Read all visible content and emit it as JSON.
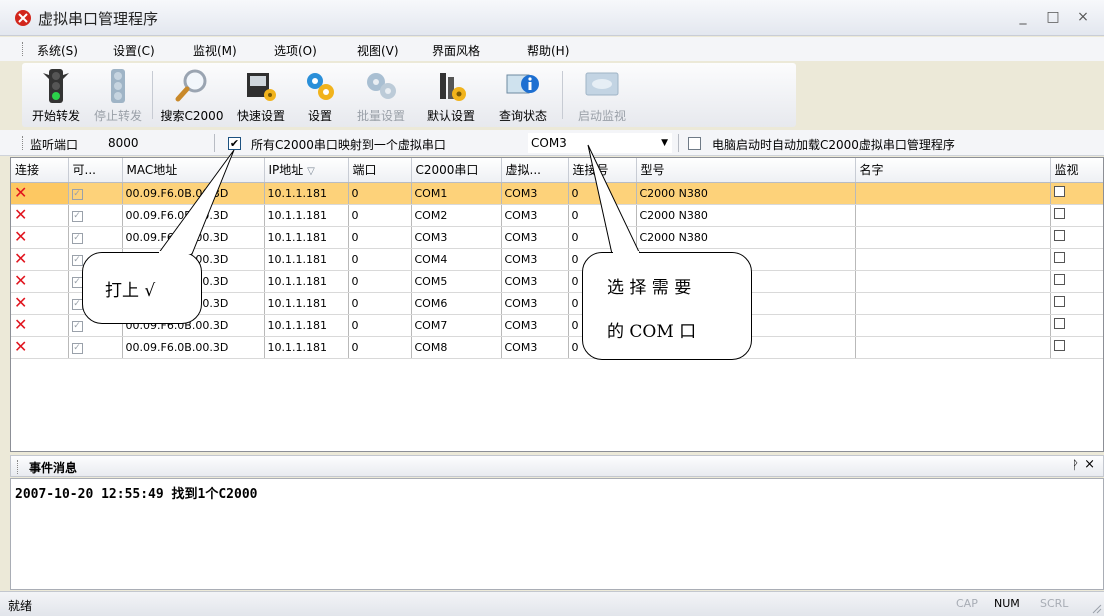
{
  "window": {
    "title": "虚拟串口管理程序",
    "controls": [
      "_",
      "□",
      "×"
    ]
  },
  "menu": [
    {
      "label": "系统(S)"
    },
    {
      "label": "设置(C)"
    },
    {
      "label": "监视(M)"
    },
    {
      "label": "选项(O)"
    },
    {
      "label": "视图(V)"
    },
    {
      "label": "界面风格"
    },
    {
      "label": "帮助(H)"
    }
  ],
  "toolbar": [
    {
      "label": "开始转发",
      "icon": "traffic-light-icon",
      "enabled": true
    },
    {
      "label": "停止转发",
      "icon": "traffic-light-icon",
      "enabled": false
    },
    {
      "label": "搜索C2000",
      "icon": "magnifier-icon",
      "enabled": true
    },
    {
      "label": "快速设置",
      "icon": "quick-setup-icon",
      "enabled": true
    },
    {
      "label": "设置",
      "icon": "gears-icon",
      "enabled": true
    },
    {
      "label": "批量设置",
      "icon": "batch-gears-icon",
      "enabled": false
    },
    {
      "label": "默认设置",
      "icon": "tools-icon",
      "enabled": true
    },
    {
      "label": "查询状态",
      "icon": "info-monitor-icon",
      "enabled": true
    },
    {
      "label": "启动监视",
      "icon": "monitor-icon",
      "enabled": false
    }
  ],
  "options": {
    "listen_port_label": "监听端口",
    "listen_port_value": "8000",
    "map_all_label": "所有C2000串口映射到一个虚拟串口",
    "map_all_checked": "✔",
    "virtual_port": "COM3",
    "autoload_label": "电脑启动时自动加载C2000虚拟串口管理程序",
    "autoload_checked": ""
  },
  "grid": {
    "columns": [
      "连接",
      "可...",
      "MAC地址",
      "IP地址",
      "端口",
      "C2000串口",
      "虚拟...",
      "连接号",
      "型号",
      "名字",
      "监视"
    ],
    "sort_indicator": "▽",
    "rows": [
      {
        "mac": "00.09.F6.0B.00.3D",
        "ip": "10.1.1.181",
        "port": "0",
        "c2000": "COM1",
        "virtual": "COM3",
        "conn": "0",
        "model": "C2000 N380",
        "name": ""
      },
      {
        "mac": "00.09.F6.0B.00.3D",
        "ip": "10.1.1.181",
        "port": "0",
        "c2000": "COM2",
        "virtual": "COM3",
        "conn": "0",
        "model": "C2000 N380",
        "name": ""
      },
      {
        "mac": "00.09.F6.0B.00.3D",
        "ip": "10.1.1.181",
        "port": "0",
        "c2000": "COM3",
        "virtual": "COM3",
        "conn": "0",
        "model": "C2000 N380",
        "name": ""
      },
      {
        "mac": "00.09.F6.0B.00.3D",
        "ip": "10.1.1.181",
        "port": "0",
        "c2000": "COM4",
        "virtual": "COM3",
        "conn": "0",
        "model": "",
        "name": ""
      },
      {
        "mac": "00.09.F6.0B.00.3D",
        "ip": "10.1.1.181",
        "port": "0",
        "c2000": "COM5",
        "virtual": "COM3",
        "conn": "0",
        "model": "",
        "name": ""
      },
      {
        "mac": "00.09.F6.0B.00.3D",
        "ip": "10.1.1.181",
        "port": "0",
        "c2000": "COM6",
        "virtual": "COM3",
        "conn": "0",
        "model": "",
        "name": ""
      },
      {
        "mac": "00.09.F6.0B.00.3D",
        "ip": "10.1.1.181",
        "port": "0",
        "c2000": "COM7",
        "virtual": "COM3",
        "conn": "0",
        "model": "",
        "name": ""
      },
      {
        "mac": "00.09.F6.0B.00.3D",
        "ip": "10.1.1.181",
        "port": "0",
        "c2000": "COM8",
        "virtual": "COM3",
        "conn": "0",
        "model": "",
        "name": ""
      }
    ],
    "conn_mark": "✕",
    "avail_mark": "✓"
  },
  "callouts": {
    "check_hint": "打上 √",
    "com_hint_line1": "选 择 需 要",
    "com_hint_line2": "的 COM 口"
  },
  "events": {
    "title": "事件消息",
    "pin": "ᚹ",
    "close": "×",
    "lines": [
      "2007-10-20 12:55:49  找到1个C2000"
    ]
  },
  "status": {
    "text": "就绪",
    "indicators": [
      {
        "label": "CAP",
        "active": false
      },
      {
        "label": "NUM",
        "active": true
      },
      {
        "label": "SCRL",
        "active": false
      }
    ]
  }
}
